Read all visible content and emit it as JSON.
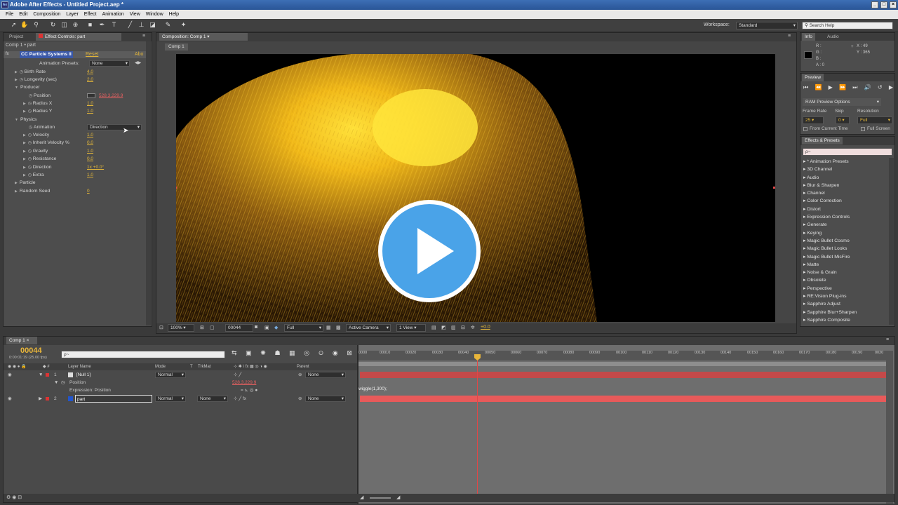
{
  "window": {
    "title": "Adobe After Effects - Untitled Project.aep *",
    "app_icon": "Ae"
  },
  "menu": [
    "File",
    "Edit",
    "Composition",
    "Layer",
    "Effect",
    "Animation",
    "View",
    "Window",
    "Help"
  ],
  "toolbar": {
    "workspace_label": "Workspace:",
    "workspace_value": "Standard",
    "search_placeholder": "Search Help"
  },
  "project_panel": {
    "tab_project": "Project",
    "tab_effect_controls": "Effect Controls: part",
    "breadcrumb": "Comp 1 • part"
  },
  "effect": {
    "name": "CC Particle Systems II",
    "reset": "Reset",
    "about": "Abo",
    "presets_label": "Animation Presets:",
    "presets_value": "None",
    "props": [
      {
        "label": "Birth Rate",
        "value": "4.0"
      },
      {
        "label": "Longevity (sec)",
        "value": "2.0"
      },
      {
        "label": "Producer",
        "value": ""
      },
      {
        "label": "Position",
        "value": "528.3,229.9"
      },
      {
        "label": "Radius X",
        "value": "1.0"
      },
      {
        "label": "Radius Y",
        "value": "1.0"
      },
      {
        "label": "Physics",
        "value": ""
      },
      {
        "label": "Animation",
        "value": "Direction"
      },
      {
        "label": "Velocity",
        "value": "1.0"
      },
      {
        "label": "Inherit Velocity %",
        "value": "0.0"
      },
      {
        "label": "Gravity",
        "value": "1.0"
      },
      {
        "label": "Resistance",
        "value": "0.0"
      },
      {
        "label": "Direction",
        "value": "1x +0.0°"
      },
      {
        "label": "Extra",
        "value": "1.0"
      },
      {
        "label": "Particle",
        "value": ""
      },
      {
        "label": "Random Seed",
        "value": "0"
      }
    ]
  },
  "composition": {
    "tab": "Composition: Comp 1",
    "subtab": "Comp 1",
    "zoom": "100%",
    "timecode": "00044",
    "resolution": "Full",
    "camera": "Active Camera",
    "view": "1 View",
    "exposure": "+0.0"
  },
  "info": {
    "tab_info": "Info",
    "tab_audio": "Audio",
    "r": "R :",
    "g": "G :",
    "b": "B :",
    "a": "A : 0",
    "x": "X : 49",
    "y": "Y : 365"
  },
  "preview": {
    "tab": "Preview",
    "ram_options": "RAM Preview Options",
    "frame_rate_label": "Frame Rate",
    "skip_label": "Skip",
    "resolution_label": "Resolution",
    "frame_rate": "25",
    "skip": "0",
    "resolution": "Full",
    "from_current": "From Current Time",
    "full_screen": "Full Screen"
  },
  "effects_presets": {
    "tab": "Effects & Presets",
    "search_placeholder": "ρ~",
    "items": [
      "* Animation Presets",
      "3D Channel",
      "Audio",
      "Blur & Sharpen",
      "Channel",
      "Color Correction",
      "Distort",
      "Expression Controls",
      "Generate",
      "Keying",
      "Magic Bullet Cosmo",
      "Magic Bullet Looks",
      "Magic Bullet MisFire",
      "Matte",
      "Noise & Grain",
      "Obsolete",
      "Perspective",
      "RE:Vision Plug-ins",
      "Sapphire Adjust",
      "Sapphire Blur+Sharpen",
      "Sapphire Composite"
    ]
  },
  "timeline": {
    "tab": "Comp 1",
    "timecode": "00044",
    "fps": "0:00:01:19 (25.00 fps)",
    "search_placeholder": "ρ~",
    "headers": {
      "layer_name": "Layer Name",
      "mode": "Mode",
      "t": "T",
      "trkmat": "TrkMat",
      "parent": "Parent"
    },
    "layers": [
      {
        "num": "1",
        "name": "[Null 1]",
        "mode": "Normal",
        "trkmat": "",
        "parent": "None",
        "color": "#d8d8d8"
      },
      {
        "num": "2",
        "name": "part",
        "mode": "Normal",
        "trkmat": "None",
        "parent": "None",
        "color": "#2255cc"
      }
    ],
    "position_label": "Position",
    "position_value": "528.3,229.9",
    "expr_label": "Expression: Position",
    "expression": "wiggle(1,300);",
    "ticks": [
      "0000",
      "00010",
      "00020",
      "00030",
      "00040",
      "00050",
      "00060",
      "00070",
      "00080",
      "00090",
      "00100",
      "00110",
      "00120",
      "00130",
      "00140",
      "00150",
      "00160",
      "00170",
      "00180",
      "00190",
      "0020"
    ]
  },
  "colors": {
    "accent": "#e8b53a",
    "playhead": "#e04848",
    "layer_bar": "#c44a4a",
    "play_button": "#4aa3e8"
  }
}
